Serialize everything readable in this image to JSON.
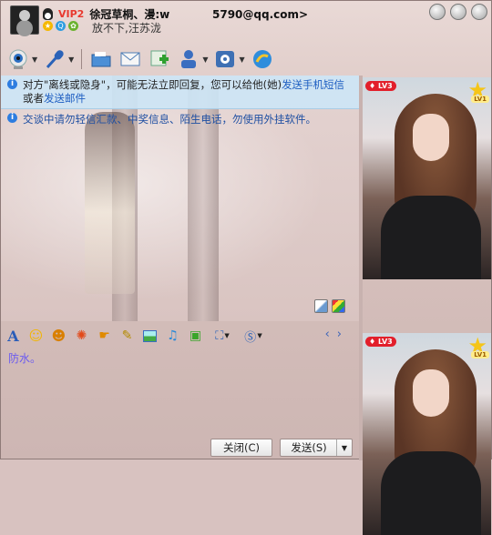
{
  "header": {
    "vip": "VIP2",
    "nickname": "徐冠草桐、漫:w",
    "email": "5790@qq.com>",
    "signature": "放不下,汪苏泷"
  },
  "toolbar": {
    "items": [
      "video-call-icon",
      "voice-call-icon",
      "send-file-icon",
      "send-email-icon",
      "create-group-icon",
      "view-profile-icon",
      "settings-icon",
      "app-icon"
    ]
  },
  "chat": {
    "notice_pre": "对方\"离线或隐身\"，可能无法立即回复，您可以给他(她)",
    "notice_link1": "发送手机短信",
    "notice_mid": "或者",
    "notice_link2": "发送邮件",
    "warning": "交谈中请勿轻信汇款、中奖信息、陌生电话，勿使用外挂软件。"
  },
  "format_toolbar": {
    "font_label": "A",
    "nav_prev": "‹",
    "nav_next": "›"
  },
  "input": {
    "text": "防水。"
  },
  "buttons": {
    "close": "关闭(C)",
    "send": "发送(S)",
    "send_dropdown": "▼"
  },
  "side": {
    "level_badge": "LV3",
    "star_level": "LV1"
  }
}
